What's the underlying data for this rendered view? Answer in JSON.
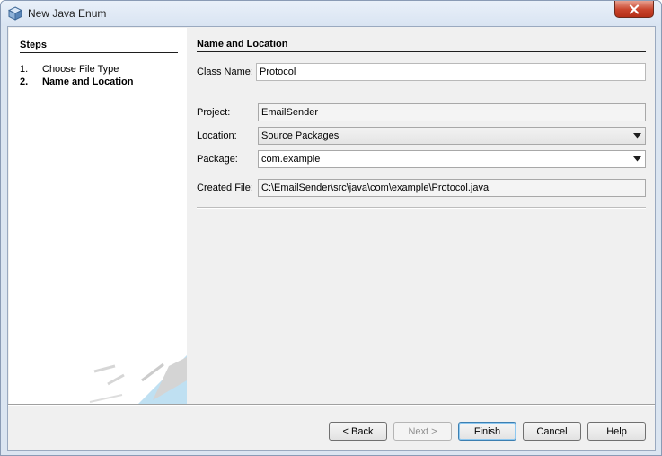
{
  "window": {
    "title": "New Java Enum"
  },
  "steps": {
    "heading": "Steps",
    "items": [
      {
        "number": "1.",
        "label": "Choose File Type",
        "current": false
      },
      {
        "number": "2.",
        "label": "Name and Location",
        "current": true
      }
    ]
  },
  "main": {
    "heading": "Name and Location",
    "class_name": {
      "label": "Class Name:",
      "value": "Protocol"
    },
    "project": {
      "label": "Project:",
      "value": "EmailSender"
    },
    "location": {
      "label": "Location:",
      "value": "Source Packages"
    },
    "package": {
      "label": "Package:",
      "value": "com.example"
    },
    "created_file": {
      "label": "Created File:",
      "value": "C:\\EmailSender\\src\\java\\com\\example\\Protocol.java"
    }
  },
  "buttons": {
    "back": "< Back",
    "next": "Next >",
    "finish": "Finish",
    "cancel": "Cancel",
    "help": "Help"
  },
  "colors": {
    "close_button": "#c8432b",
    "default_button_border": "#3c7fb1"
  }
}
